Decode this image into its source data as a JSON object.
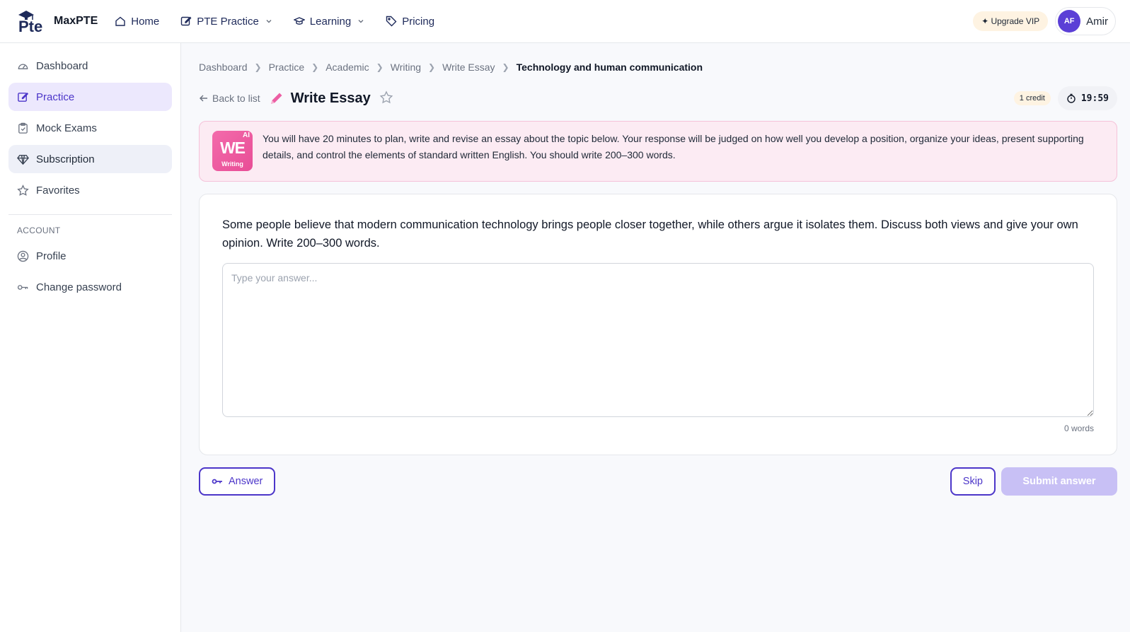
{
  "app": {
    "name": "MaxPTE",
    "logo_text": "Pte"
  },
  "nav": {
    "items": [
      {
        "label": "Home",
        "icon": "home-icon"
      },
      {
        "label": "PTE Practice",
        "icon": "edit-icon",
        "dropdown": true
      },
      {
        "label": "Learning",
        "icon": "graduation-cap-icon",
        "dropdown": true
      },
      {
        "label": "Pricing",
        "icon": "tag-icon"
      }
    ],
    "upgrade_label": "✦ Upgrade VIP",
    "user": {
      "initials": "AF",
      "name": "Amir"
    }
  },
  "sidebar": {
    "items": [
      {
        "label": "Dashboard",
        "icon": "gauge-icon",
        "state": "normal"
      },
      {
        "label": "Practice",
        "icon": "edit-icon",
        "state": "active"
      },
      {
        "label": "Mock Exams",
        "icon": "clipboard-icon",
        "state": "normal"
      },
      {
        "label": "Subscription",
        "icon": "diamond-icon",
        "state": "hover"
      },
      {
        "label": "Favorites",
        "icon": "star-icon",
        "state": "normal"
      }
    ],
    "account_section": "ACCOUNT",
    "account_items": [
      {
        "label": "Profile",
        "icon": "user-circle-icon"
      },
      {
        "label": "Change password",
        "icon": "key-icon"
      }
    ]
  },
  "breadcrumb": [
    "Dashboard",
    "Practice",
    "Academic",
    "Writing",
    "Write Essay",
    "Technology and human communication"
  ],
  "header": {
    "back_label": "Back to list",
    "title": "Write Essay",
    "credit": "1 credit",
    "timer": "19:59"
  },
  "instructions": {
    "badge": {
      "ai": "AI",
      "code": "WE",
      "label": "Writing"
    },
    "text": "You will have 20 minutes to plan, write and revise an essay about the topic below. Your response will be judged on how well you develop a position, organize your ideas, present supporting details, and control the elements of standard written English. You should write 200–300 words."
  },
  "question": {
    "prompt": "Some people believe that modern communication technology brings people closer together, while others argue it isolates them. Discuss both views and give your own opinion. Write 200–300 words.",
    "placeholder": "Type your answer...",
    "value": "",
    "word_count": "0 words"
  },
  "actions": {
    "answer_label": "Answer",
    "skip_label": "Skip",
    "submit_label": "Submit answer"
  },
  "colors": {
    "accent": "#4c36c9",
    "active_bg": "#ece8fd",
    "info_bg": "#fcebf3",
    "badge_pink": "#e84d96",
    "submit_disabled": "#c8c0f5"
  }
}
